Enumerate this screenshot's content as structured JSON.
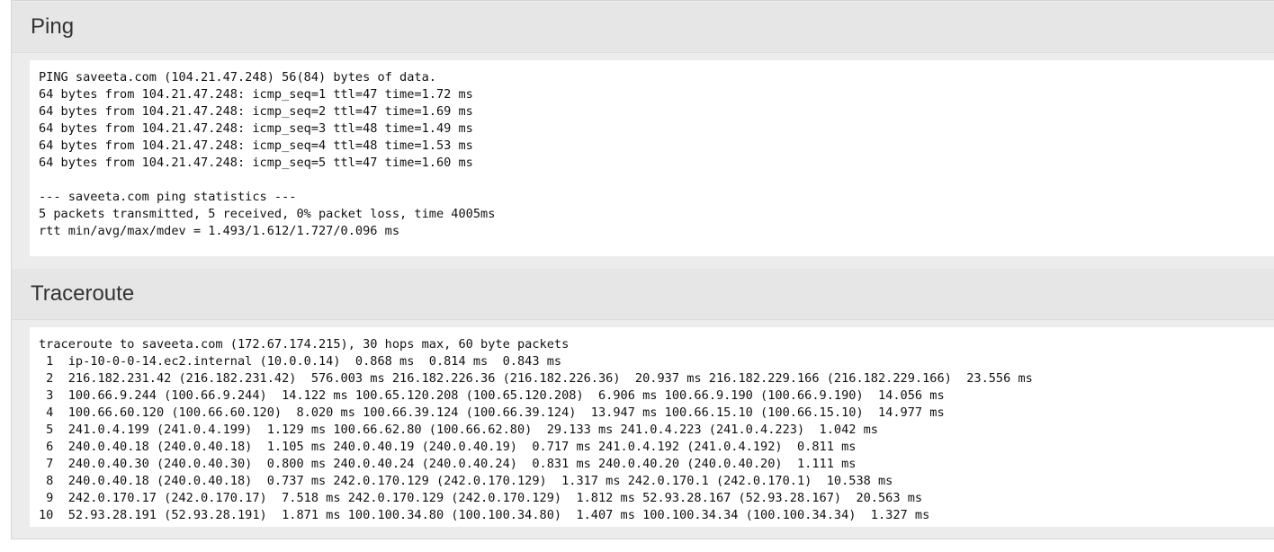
{
  "ping": {
    "title": "Ping",
    "lines": [
      "PING saveeta.com (104.21.47.248) 56(84) bytes of data.",
      "64 bytes from 104.21.47.248: icmp_seq=1 ttl=47 time=1.72 ms",
      "64 bytes from 104.21.47.248: icmp_seq=2 ttl=47 time=1.69 ms",
      "64 bytes from 104.21.47.248: icmp_seq=3 ttl=48 time=1.49 ms",
      "64 bytes from 104.21.47.248: icmp_seq=4 ttl=48 time=1.53 ms",
      "64 bytes from 104.21.47.248: icmp_seq=5 ttl=47 time=1.60 ms",
      "",
      "--- saveeta.com ping statistics ---",
      "5 packets transmitted, 5 received, 0% packet loss, time 4005ms",
      "rtt min/avg/max/mdev = 1.493/1.612/1.727/0.096 ms"
    ]
  },
  "traceroute": {
    "title": "Traceroute",
    "lines": [
      "traceroute to saveeta.com (172.67.174.215), 30 hops max, 60 byte packets",
      " 1  ip-10-0-0-14.ec2.internal (10.0.0.14)  0.868 ms  0.814 ms  0.843 ms",
      " 2  216.182.231.42 (216.182.231.42)  576.003 ms 216.182.226.36 (216.182.226.36)  20.937 ms 216.182.229.166 (216.182.229.166)  23.556 ms",
      " 3  100.66.9.244 (100.66.9.244)  14.122 ms 100.65.120.208 (100.65.120.208)  6.906 ms 100.66.9.190 (100.66.9.190)  14.056 ms",
      " 4  100.66.60.120 (100.66.60.120)  8.020 ms 100.66.39.124 (100.66.39.124)  13.947 ms 100.66.15.10 (100.66.15.10)  14.977 ms",
      " 5  241.0.4.199 (241.0.4.199)  1.129 ms 100.66.62.80 (100.66.62.80)  29.133 ms 241.0.4.223 (241.0.4.223)  1.042 ms",
      " 6  240.0.40.18 (240.0.40.18)  1.105 ms 240.0.40.19 (240.0.40.19)  0.717 ms 241.0.4.192 (241.0.4.192)  0.811 ms",
      " 7  240.0.40.30 (240.0.40.30)  0.800 ms 240.0.40.24 (240.0.40.24)  0.831 ms 240.0.40.20 (240.0.40.20)  1.111 ms",
      " 8  240.0.40.18 (240.0.40.18)  0.737 ms 242.0.170.129 (242.0.170.129)  1.317 ms 242.0.170.1 (242.0.170.1)  10.538 ms",
      " 9  242.0.170.17 (242.0.170.17)  7.518 ms 242.0.170.129 (242.0.170.129)  1.812 ms 52.93.28.167 (52.93.28.167)  20.563 ms",
      "10  52.93.28.191 (52.93.28.191)  1.871 ms 100.100.34.80 (100.100.34.80)  1.407 ms 100.100.34.34 (100.100.34.34)  1.327 ms"
    ]
  }
}
